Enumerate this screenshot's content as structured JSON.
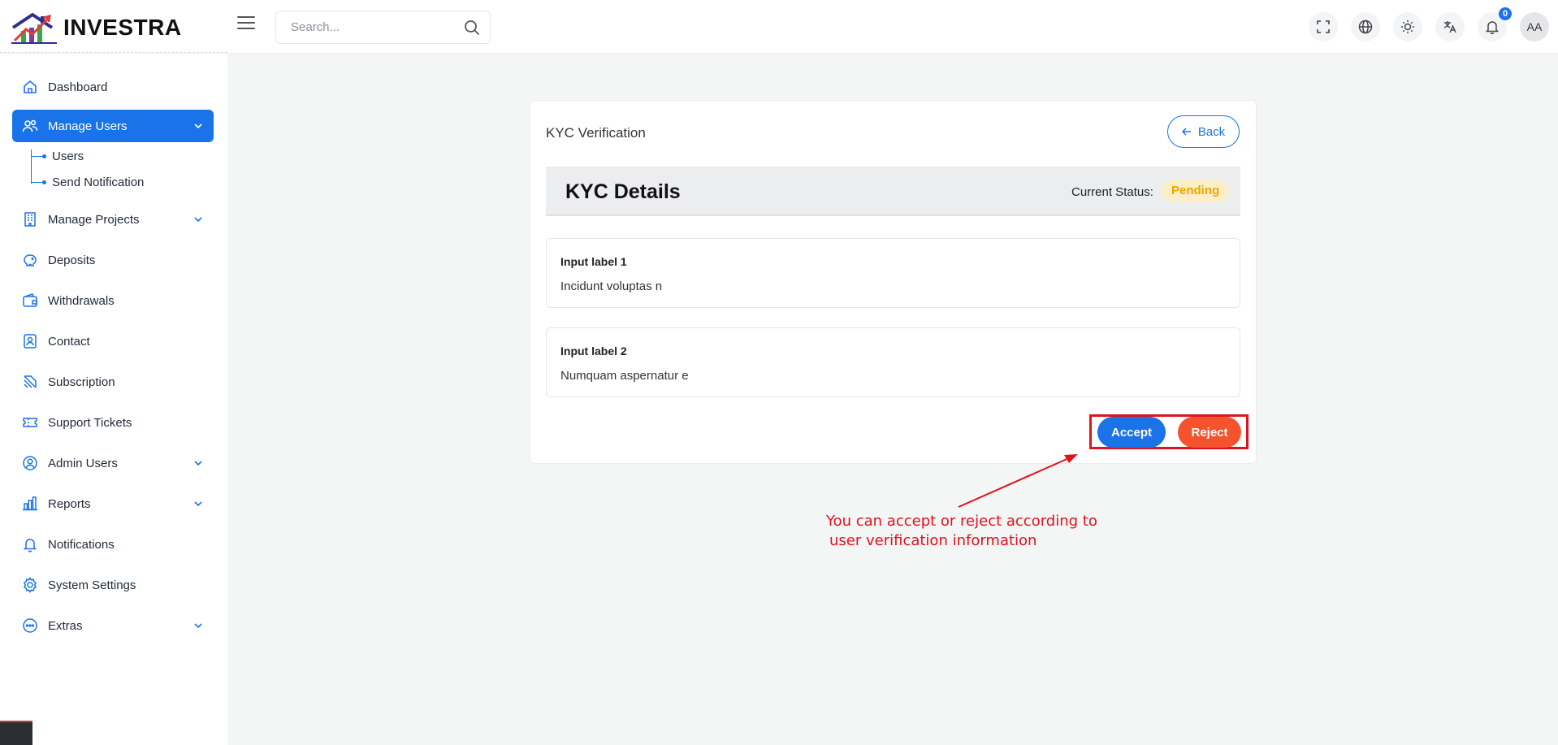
{
  "brand": {
    "name": "INVESTRA"
  },
  "search": {
    "placeholder": "Search..."
  },
  "topbar": {
    "notification_count": "0",
    "avatar_initials": "AA"
  },
  "sidebar": {
    "items": [
      {
        "label": "Dashboard",
        "icon": "home-icon"
      },
      {
        "label": "Manage Users",
        "icon": "users-icon",
        "expanded": true,
        "active": true,
        "children": [
          {
            "label": "Users"
          },
          {
            "label": "Send Notification"
          }
        ]
      },
      {
        "label": "Manage Projects",
        "icon": "building-icon"
      },
      {
        "label": "Deposits",
        "icon": "piggy-bank-icon"
      },
      {
        "label": "Withdrawals",
        "icon": "wallet-icon"
      },
      {
        "label": "Contact",
        "icon": "contact-icon"
      },
      {
        "label": "Subscription",
        "icon": "subscription-icon"
      },
      {
        "label": "Support Tickets",
        "icon": "ticket-icon"
      },
      {
        "label": "Admin Users",
        "icon": "admin-user-icon"
      },
      {
        "label": "Reports",
        "icon": "bar-chart-icon"
      },
      {
        "label": "Notifications",
        "icon": "bell-icon"
      },
      {
        "label": "System Settings",
        "icon": "gear-icon"
      },
      {
        "label": "Extras",
        "icon": "more-circle-icon"
      }
    ]
  },
  "card": {
    "title": "KYC Verification",
    "back_label": "Back",
    "details_title": "KYC Details",
    "status_label": "Current Status:",
    "status_value": "Pending",
    "fields": [
      {
        "label": "Input label 1",
        "value": "Incidunt voluptas n"
      },
      {
        "label": "Input label 2",
        "value": "Numquam aspernatur e"
      }
    ],
    "accept_label": "Accept",
    "reject_label": "Reject"
  },
  "annotation": {
    "line1": "You can accept or reject according to",
    "line2": "user verification information"
  },
  "colors": {
    "primary": "#1a73e8",
    "reject": "#f4532d",
    "pending_text": "#f0a500",
    "annotation": "#e0121b"
  }
}
